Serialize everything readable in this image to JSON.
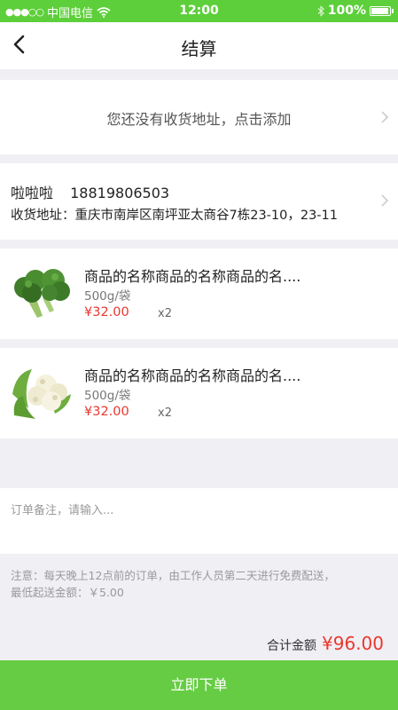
{
  "status_bar": {
    "signal": "●●●○○",
    "carrier": "中国电信",
    "time": "12:00",
    "battery": "100%",
    "battery_level": 1.0
  },
  "nav": {
    "title": "结算"
  },
  "address_empty": {
    "text": "您还没有收货地址，点击添加"
  },
  "address": {
    "name": "啦啦啦",
    "phone": "18819806503",
    "label": "收货地址：",
    "detail": "重庆市南岸区南坪亚太商谷7栋23-10，23-11"
  },
  "goods": [
    {
      "name": "商品的名称商品的名称商品的名....",
      "spec": "500g/袋",
      "price": "¥32.00",
      "qty": "x2",
      "image": "broccoli"
    },
    {
      "name": "商品的名称商品的名称商品的名....",
      "spec": "500g/袋",
      "price": "¥32.00",
      "qty": "x2",
      "image": "cauliflower"
    }
  ],
  "remark": {
    "placeholder": "订单备注，请输入..."
  },
  "notice": {
    "line1": "注意：每天晚上12点前的订单，由工作人员第二天进行免费配送，",
    "line2": "最低起送金额：￥5.00"
  },
  "total": {
    "label": "合计金额",
    "amount": "¥96.00"
  },
  "submit": {
    "label": "立即下单"
  },
  "colors": {
    "brand_green": "#5dcf3a",
    "button_green": "#66cc44",
    "price_red": "#e8382e"
  }
}
